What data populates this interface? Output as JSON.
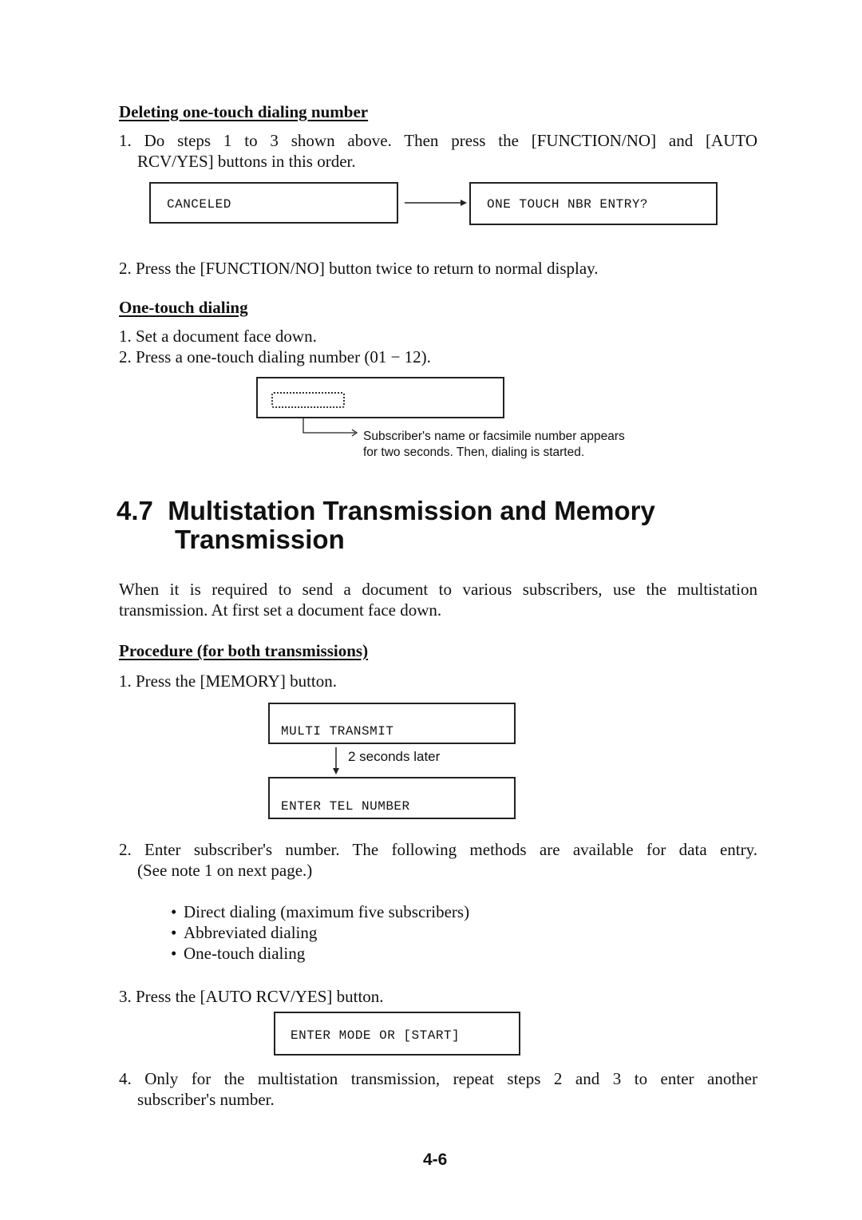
{
  "delete_section": {
    "title": "Deleting one-touch dialing number",
    "step1_line1": "1. Do steps 1 to 3 shown above. Then press the [FUNCTION/NO] and [AUTO",
    "step1_line2": "RCV/YES] buttons in this order.",
    "display_1": "CANCELED",
    "display_2": "ONE TOUCH NBR ENTRY?",
    "step2": "2. Press the [FUNCTION/NO] button twice to return to normal display."
  },
  "onetouch_section": {
    "title": "One-touch dialing",
    "step1": "1. Set a document face down.",
    "step2": "2. Press a one-touch dialing number (01 − 12).",
    "note_line1": "Subscriber's name or facsimile number appears",
    "note_line2": "for two seconds. Then, dialing is started."
  },
  "section_4_7": {
    "heading_line1": "4.7  Multistation Transmission and Memory",
    "heading_line2": "Transmission",
    "intro_line1": "When it is required to send a document to various subscribers, use the multistation",
    "intro_line2": "transmission. At first set a document face down.",
    "procedure_title": "Procedure (for both transmissions)",
    "step1": "1. Press the [MEMORY] button.",
    "display_multi": "MULTI TRANSMIT",
    "delay_label": "2 seconds later",
    "display_tel": "ENTER TEL NUMBER",
    "step2_line1": "2. Enter subscriber's number. The following methods are available for data entry.",
    "step2_line2": "(See note 1 on next page.)",
    "methods": [
      "Direct dialing (maximum five subscribers)",
      "Abbreviated dialing",
      "One-touch dialing"
    ],
    "step3": "3. Press the [AUTO RCV/YES] button.",
    "display_mode": "ENTER MODE OR [START]",
    "step4_line1": "4. Only for the multistation transmission, repeat steps 2 and 3 to enter another",
    "step4_line2": "subscriber's number."
  },
  "page_number": "4-6"
}
